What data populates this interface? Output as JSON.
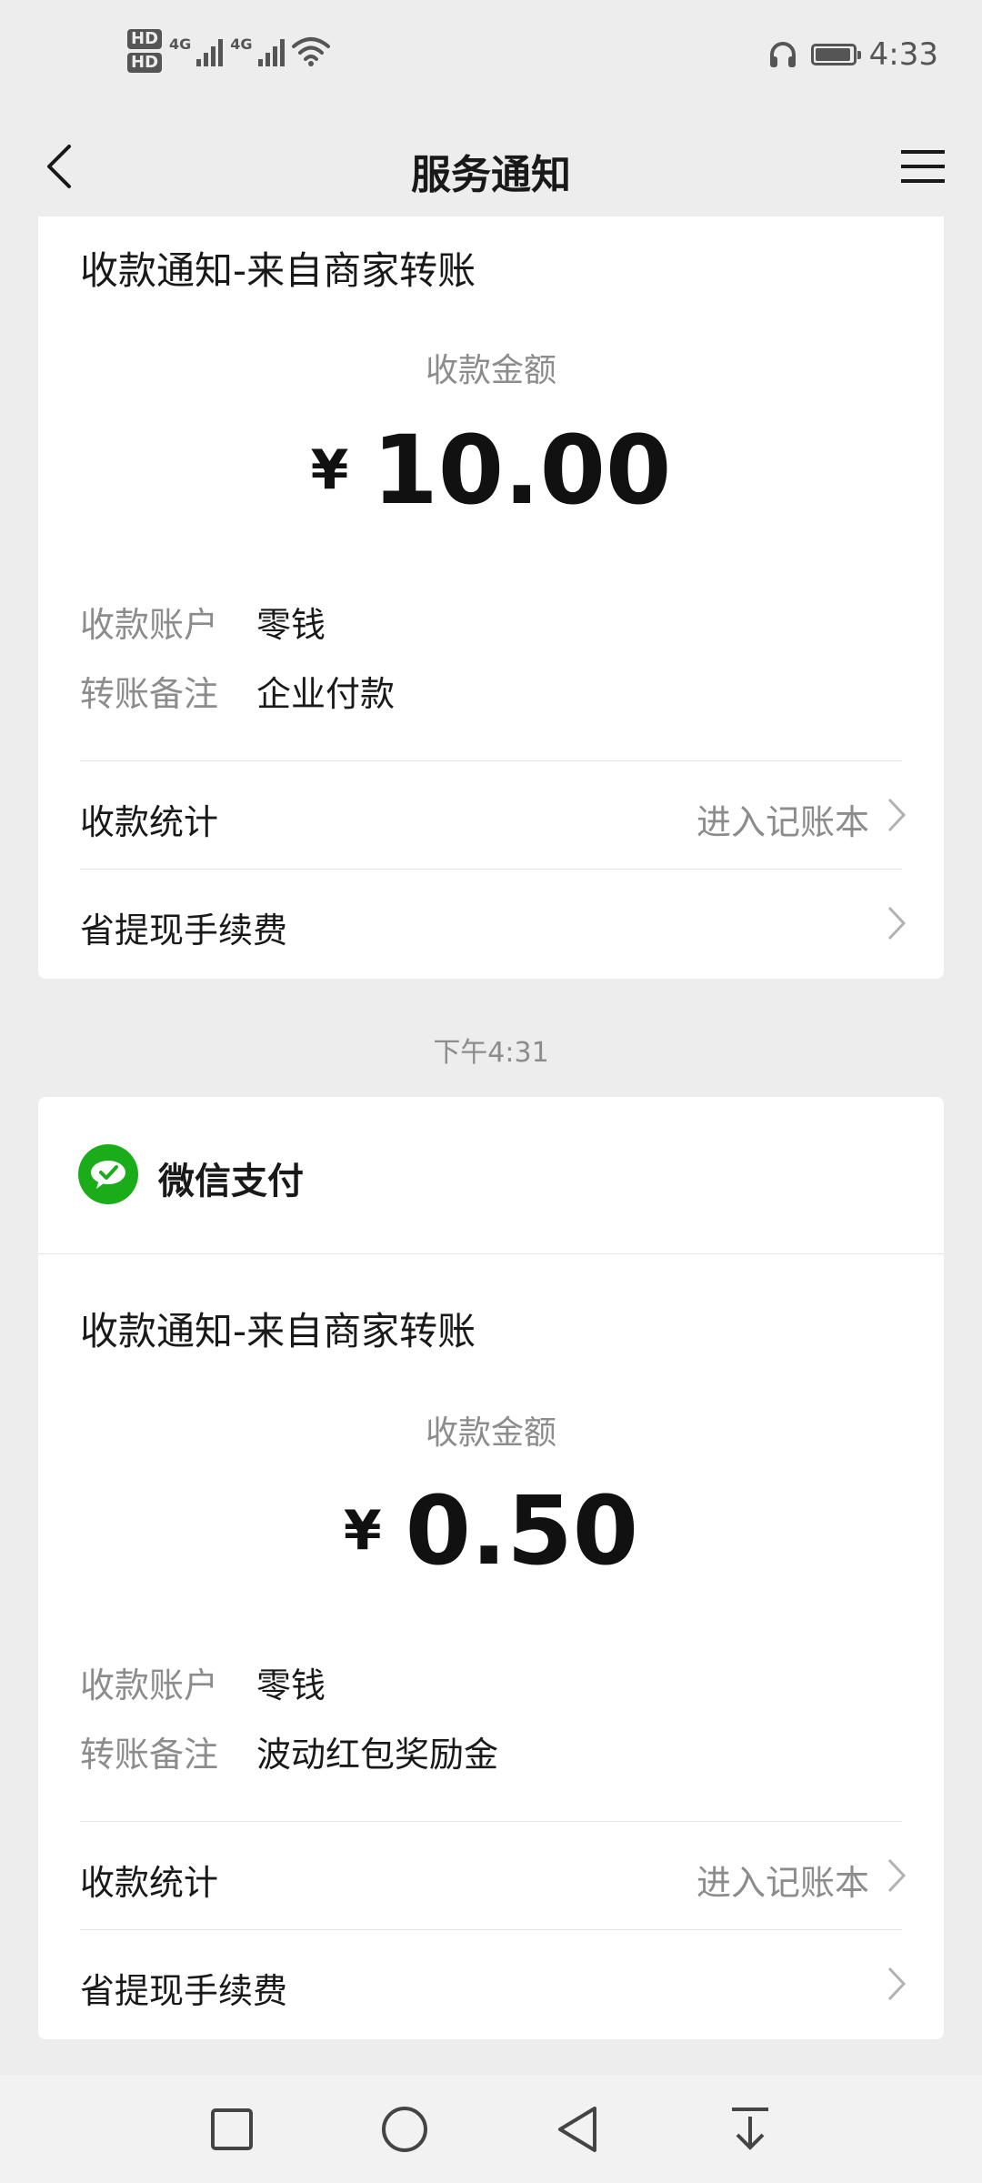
{
  "status_bar": {
    "sim1": "HD",
    "sim2": "HD",
    "net1": "4G",
    "net2": "4G",
    "time": "4:33",
    "battery_level": 0.95
  },
  "navbar": {
    "title": "服务通知",
    "back_icon": "chevron-left-icon",
    "menu_icon": "hamburger-menu-icon"
  },
  "cards": [
    {
      "title": "收款通知-来自商家转账",
      "amount_label": "收款金额",
      "currency": "¥",
      "amount": "10.00",
      "account_label": "收款账户",
      "account_value": "零钱",
      "note_label": "转账备注",
      "note_value": "企业付款",
      "stats_label": "收款统计",
      "stats_link": "进入记账本",
      "fee_label": "省提现手续费"
    },
    {
      "brand_name": "微信支付",
      "title": "收款通知-来自商家转账",
      "amount_label": "收款金额",
      "currency": "¥",
      "amount": "0.50",
      "account_label": "收款账户",
      "account_value": "零钱",
      "note_label": "转账备注",
      "note_value": "波动红包奖励金",
      "stats_label": "收款统计",
      "stats_link": "进入记账本",
      "fee_label": "省提现手续费"
    }
  ],
  "timestamp": "下午4:31",
  "colors": {
    "background": "#ededed",
    "card": "#ffffff",
    "wechat_green": "#1aad19",
    "secondary_text": "#8c8c8c"
  }
}
